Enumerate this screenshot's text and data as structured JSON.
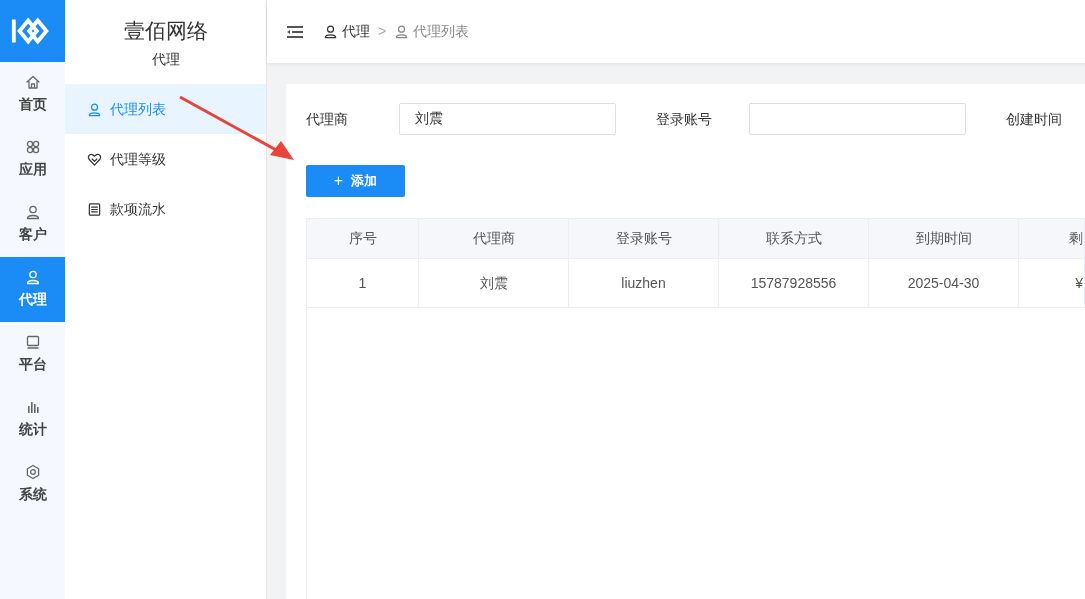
{
  "brand": {
    "title": "壹佰网络",
    "section": "代理"
  },
  "nav": [
    {
      "label": "首页",
      "kind": "home",
      "selected": false
    },
    {
      "label": "应用",
      "kind": "apps",
      "selected": false
    },
    {
      "label": "客户",
      "kind": "user",
      "selected": false
    },
    {
      "label": "代理",
      "kind": "user",
      "selected": true
    },
    {
      "label": "平台",
      "kind": "monitor",
      "selected": false
    },
    {
      "label": "统计",
      "kind": "chart",
      "selected": false
    },
    {
      "label": "系统",
      "kind": "gear",
      "selected": false
    }
  ],
  "submenu": [
    {
      "label": "代理列表",
      "kind": "user",
      "selected": true
    },
    {
      "label": "代理等级",
      "kind": "heart",
      "selected": false
    },
    {
      "label": "款项流水",
      "kind": "list",
      "selected": false
    }
  ],
  "breadcrumb": [
    "代理",
    "代理列表"
  ],
  "breadcrumb_separator": ">",
  "filters": [
    {
      "label": "代理商",
      "kind": "input",
      "value": "刘震"
    },
    {
      "label": "登录账号",
      "kind": "input"
    },
    {
      "label": "创建时间",
      "kind": "label"
    }
  ],
  "add_button": {
    "icon": "+",
    "label": "添加"
  },
  "table": {
    "columns": [
      "序号",
      "代理商",
      "登录账号",
      "联系方式",
      "到期时间",
      "剩"
    ],
    "rows": [
      [
        "1",
        "刘震",
        "liuzhen",
        "15787928556",
        "2025-04-30",
        "¥"
      ]
    ]
  }
}
